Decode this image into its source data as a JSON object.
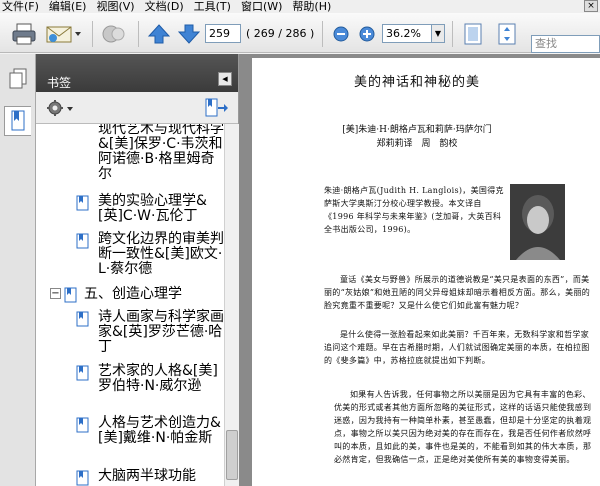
{
  "menu": {
    "items": [
      "文件(F)",
      "编辑(E)",
      "视图(V)",
      "文档(D)",
      "工具(T)",
      "窗口(W)",
      "帮助(H)"
    ],
    "close": "×"
  },
  "toolbar": {
    "page_current": "259",
    "page_total": "( 269 / 286 )",
    "zoom": "36.2%",
    "zoom_arrow": "▼",
    "search_placeholder": "查找"
  },
  "bookmarks": {
    "header": "书签",
    "collapse": "◀",
    "items": [
      {
        "text": "现代艺术与现代科学&[美]保罗·C·韦茨和阿诺德·B·格里姆奇尔",
        "indent": 1
      },
      {
        "text": "美的实验心理学&[英]C·W·瓦伦丁",
        "indent": 1
      },
      {
        "text": "跨文化边界的审美判断一致性&[美]欧文·L·蔡尔德",
        "indent": 1
      },
      {
        "text": "五、创造心理学",
        "indent": 0,
        "expander": "−"
      },
      {
        "text": "诗人画家与科学家画家&[英]罗莎芒德·哈丁",
        "indent": 1
      },
      {
        "text": "艺术家的人格&[美]罗伯特·N·威尔逊",
        "indent": 1
      },
      {
        "text": "人格与艺术创造力&[美]戴维·N·帕金斯",
        "indent": 1
      },
      {
        "text": "大脑两半球功能",
        "indent": 1
      }
    ]
  },
  "document": {
    "title": "美的神话和神秘的美",
    "authors_line1": "[美]朱迪·H·朗格卢瓦和莉萨·玛萨尔门",
    "authors_line2": "郑莉莉译　周　韵校",
    "intro": [
      "朱迪·朗格卢瓦(Judith H. Langlois)，美国得克萨斯大学奥斯汀分校心理学教授。本文译自《1996 年科学与未来年鉴》(芝加哥，大英百科全书出版公司，1996)。"
    ],
    "para1": [
      "童话《美女与野兽》所展示的道德说教是“美只是表面的东西”，而美丽的“灰姑娘”和她丑陋的同父异母姐妹却暗示着相反方面。那么，美丽的脸究竟重不重要呢？又是什么使它们如此富有魅力呢？"
    ],
    "para2": [
      "是什么使得一张脸看起来如此美丽？千百年来，无数科学家和哲学家追问这个难题。早在古希腊时期，人们就试图确定美丽的本质，在柏拉图的《斐多篇》中，苏格拉底就提出如下判断。"
    ],
    "para3": [
      "如果有人告诉我，任何事物之所以美丽是因为它具有丰富的色彩、优美的形式或者其他方面所忽略的美征形式，这样的话语只能使我感到迷惑，因为我持有一种简单朴素，甚至愚蠢，但却是十分坚定的执着观点，事物之所以美只因为绝对美的存在而存在，我是否任何作者欣然呼叫的本质，且如此的美，事件也是美的，不能看到如其的伟大本质，那必然肯定，但我确信一点，正是绝对美使所有美的事物变得美丽。"
    ]
  }
}
